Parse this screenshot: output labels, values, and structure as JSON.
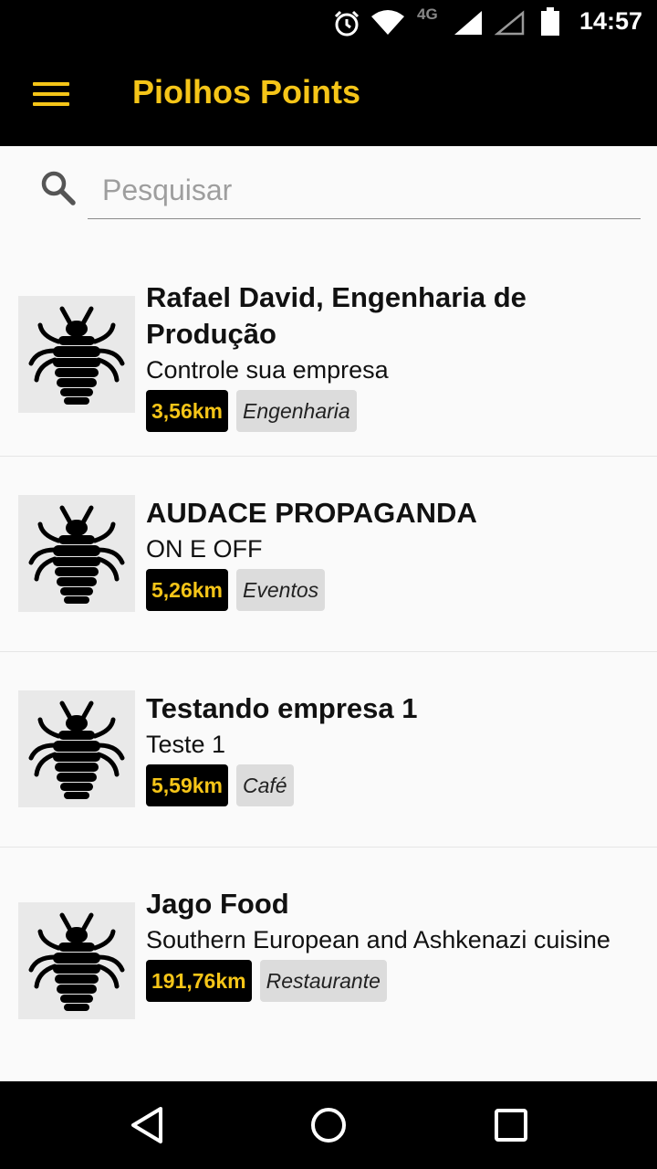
{
  "status_bar": {
    "time": "14:57",
    "network": "4G",
    "icons": [
      "alarm-icon",
      "wifi-icon",
      "signal-icon",
      "signal-empty-icon",
      "battery-icon"
    ]
  },
  "app_bar": {
    "title": "Piolhos Points",
    "menu_icon": "hamburger-menu-icon",
    "accent_color": "#f5c518",
    "background_color": "#000000"
  },
  "search": {
    "placeholder": "Pesquisar",
    "value": "",
    "icon": "search-icon"
  },
  "items": [
    {
      "name": "Rafael David, Engenharia de Produção",
      "description": "Controle sua empresa",
      "distance": "3,56km",
      "category": "Engenharia",
      "thumbnail_icon": "louse-icon"
    },
    {
      "name": "AUDACE PROPAGANDA",
      "description": "ON E OFF",
      "distance": "5,26km",
      "category": "Eventos",
      "thumbnail_icon": "louse-icon"
    },
    {
      "name": "Testando empresa 1",
      "description": "Teste 1",
      "distance": "5,59km",
      "category": "Café",
      "thumbnail_icon": "louse-icon"
    },
    {
      "name": "Jago Food",
      "description": "Southern European and Ashkenazi cuisine",
      "distance": "191,76km",
      "category": "Restaurante",
      "thumbnail_icon": "louse-icon"
    }
  ],
  "nav_bar": {
    "buttons": [
      "back-triangle-icon",
      "home-circle-icon",
      "recents-square-icon"
    ]
  }
}
